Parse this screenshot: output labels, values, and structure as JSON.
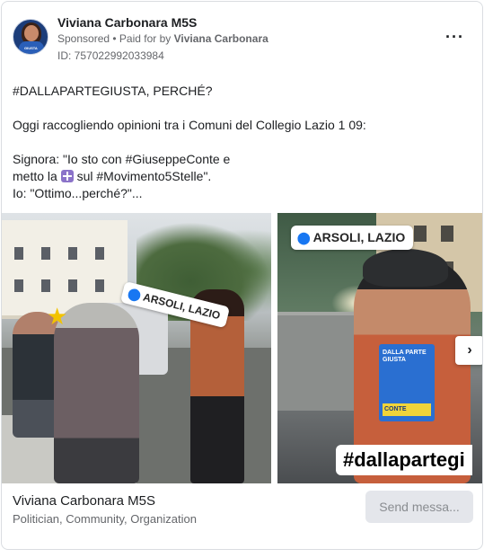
{
  "header": {
    "page_name": "Viviana Carbonara M5S",
    "sponsored": "Sponsored",
    "separator": " • ",
    "paid_for_prefix": "Paid for by ",
    "paid_for_name": "Viviana Carbonara",
    "ad_id": "ID: 757022992033984",
    "more_icon": "more-horizontal-icon",
    "avatar_tag": "GIUSTA"
  },
  "post": {
    "line1": "#DALLAPARTEGIUSTA, PERCHÉ?",
    "line2": "Oggi raccogliendo opinioni tra i Comuni del Collegio Lazio 1 09:",
    "line3": "Signora: \"Io sto con #GiuseppeConte e",
    "line4_a": "metto la ",
    "line4_emoji": "plus-emoji",
    "line4_b": " sul #Movimento5Stelle\".",
    "line5": "Io: \"Ottimo...perché?\"..."
  },
  "carousel": {
    "card1_sticker": "ARSOLI, LAZIO",
    "card2_sticker": "ARSOLI, LAZIO",
    "card2_book_title": "DALLA PARTE GIUSTA",
    "card2_book_name": "CONTE",
    "card2_hashtag": "#dallapartegi",
    "next_icon": "chevron-right-icon"
  },
  "footer": {
    "name": "Viviana Carbonara M5S",
    "categories": "Politician, Community, Organization",
    "send_button": "Send messa..."
  },
  "colors": {
    "link_blue": "#1877f2",
    "secondary_text": "#65676b",
    "button_bg": "#e4e6eb"
  }
}
